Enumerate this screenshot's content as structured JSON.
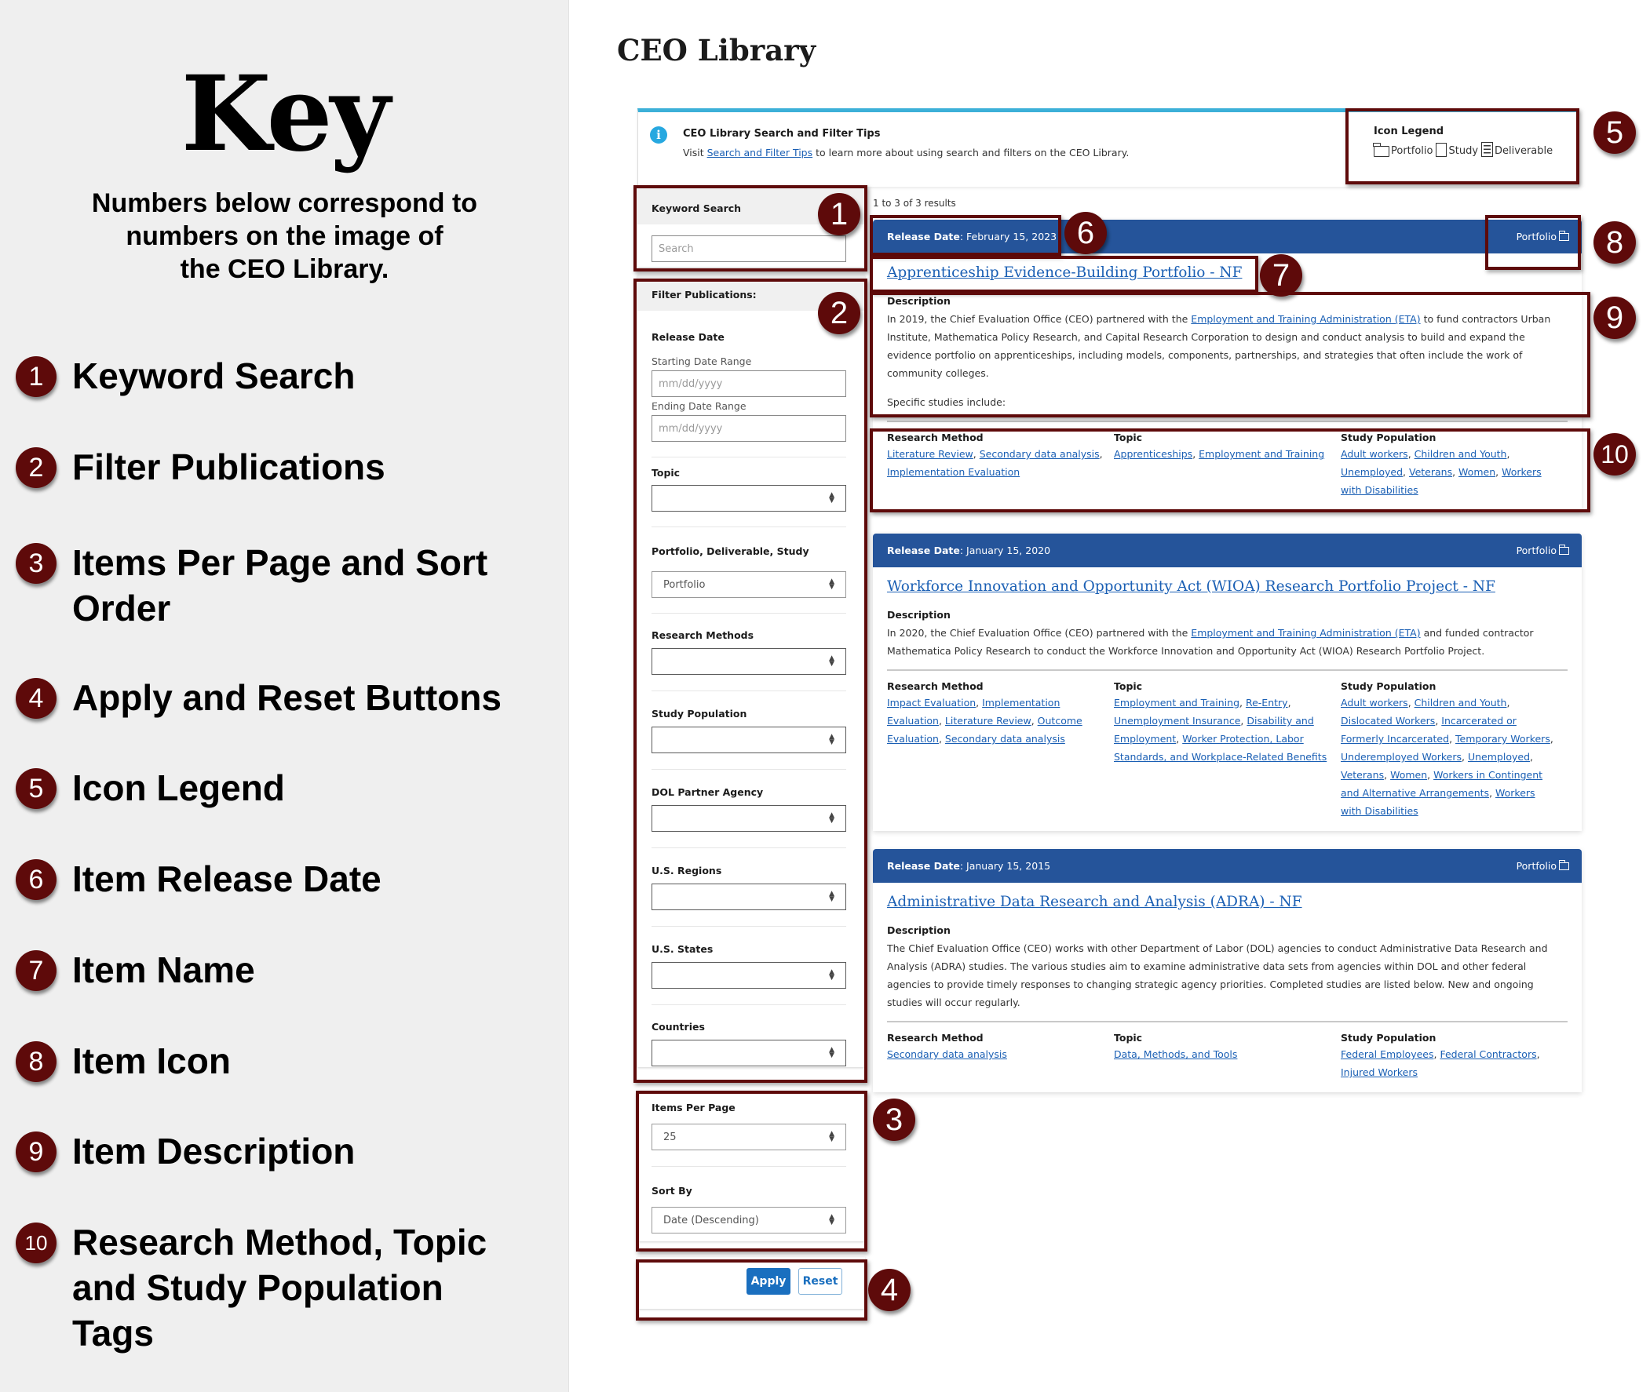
{
  "key": {
    "title": "Key",
    "subtitle_lines": [
      "Numbers below correspond to",
      "numbers on the image of",
      "the CEO Library."
    ],
    "items": [
      {
        "number": "1",
        "label": "Keyword Search"
      },
      {
        "number": "2",
        "label": "Filter Publications"
      },
      {
        "number": "3",
        "label": "Items Per Page and Sort Order"
      },
      {
        "number": "4",
        "label": "Apply and Reset Buttons"
      },
      {
        "number": "5",
        "label": "Icon Legend"
      },
      {
        "number": "6",
        "label": "Item Release Date"
      },
      {
        "number": "7",
        "label": "Item Name"
      },
      {
        "number": "8",
        "label": "Item Icon"
      },
      {
        "number": "9",
        "label": "Item Description"
      },
      {
        "number": "10",
        "label": "Research Method, Topic and Study Population Tags"
      }
    ]
  },
  "page": {
    "title": "CEO Library"
  },
  "tips": {
    "icon": "info-icon",
    "title": "CEO Library Search and Filter Tips",
    "body_prefix": "Visit ",
    "link": "Search and Filter Tips",
    "body_suffix": " to learn more about using search and filters on the CEO Library."
  },
  "legend": {
    "title": "Icon Legend",
    "items": [
      {
        "icon": "folder-icon",
        "label": "Portfolio"
      },
      {
        "icon": "document-icon",
        "label": "Study"
      },
      {
        "icon": "document-lines-icon",
        "label": "Deliverable"
      }
    ]
  },
  "sidebar": {
    "keyword": {
      "heading": "Keyword Search",
      "placeholder": "Search",
      "value": ""
    },
    "filters": {
      "heading": "Filter Publications:",
      "release_date": {
        "label": "Release Date",
        "start_label": "Starting Date Range",
        "start_placeholder": "mm/dd/yyyy",
        "end_label": "Ending Date Range",
        "end_placeholder": "mm/dd/yyyy"
      },
      "selects": [
        {
          "label": "Topic",
          "value": ""
        },
        {
          "label": "Portfolio, Deliverable, Study",
          "value": "Portfolio"
        },
        {
          "label": "Research Methods",
          "value": ""
        },
        {
          "label": "Study Population",
          "value": ""
        },
        {
          "label": "DOL Partner Agency",
          "value": ""
        },
        {
          "label": "U.S. Regions",
          "value": ""
        },
        {
          "label": "U.S. States",
          "value": ""
        },
        {
          "label": "Countries",
          "value": ""
        }
      ]
    },
    "paging": {
      "items_per_page_label": "Items Per Page",
      "items_per_page_value": "25",
      "sort_label": "Sort By",
      "sort_value": "Date (Descending)"
    },
    "buttons": {
      "apply": "Apply",
      "reset": "Reset"
    }
  },
  "results": {
    "count_text": "1 to 3 of 3 results",
    "release_label": "Release Date",
    "description_label": "Description",
    "tag_headings": {
      "method": "Research Method",
      "topic": "Topic",
      "population": "Study Population"
    },
    "items": [
      {
        "release_date": "February 15, 2023",
        "type": "Portfolio",
        "type_icon": "folder-icon",
        "title": "Apprenticeship Evidence-Building Portfolio - NF",
        "description_parts": [
          "In 2019, the Chief Evaluation Office (CEO) partnered with the ",
          "Employment and Training Administration (ETA)",
          " to fund contractors Urban Institute, Mathematica Policy Research, and Capital Research Corporation to design and conduct analysis to build and expand the evidence portfolio on apprenticeships, including models, components, partnerships, and strategies that often include the work of community colleges."
        ],
        "description_extra": "Specific studies include:",
        "methods": [
          "Literature Review",
          "Secondary data analysis",
          "Implementation Evaluation"
        ],
        "topics": [
          "Apprenticeships",
          "Employment and Training"
        ],
        "populations": [
          "Adult workers",
          "Children and Youth",
          "Unemployed",
          "Veterans",
          "Women",
          "Workers with Disabilities"
        ]
      },
      {
        "release_date": "January 15, 2020",
        "type": "Portfolio",
        "type_icon": "folder-icon",
        "title": "Workforce Innovation and Opportunity Act (WIOA) Research Portfolio Project - NF",
        "description_parts": [
          "In 2020, the Chief Evaluation Office (CEO) partnered with the ",
          "Employment and Training Administration (ETA)",
          " and funded contractor Mathematica Policy Research to conduct the Workforce Innovation and Opportunity Act (WIOA) Research Portfolio Project."
        ],
        "description_extra": "",
        "methods": [
          "Impact Evaluation",
          "Implementation Evaluation",
          "Literature Review",
          "Outcome Evaluation",
          "Secondary data analysis"
        ],
        "topics": [
          "Employment and Training",
          "Re-Entry",
          "Unemployment Insurance",
          "Disability and Employment",
          "Worker Protection, Labor Standards, and Workplace-Related Benefits"
        ],
        "populations": [
          "Adult workers",
          "Children and Youth",
          "Dislocated Workers",
          "Incarcerated or Formerly Incarcerated",
          "Temporary Workers",
          "Underemployed Workers",
          "Unemployed",
          "Veterans",
          "Women",
          "Workers in Contingent and Alternative Arrangements",
          "Workers with Disabilities"
        ]
      },
      {
        "release_date": "January 15, 2015",
        "type": "Portfolio",
        "type_icon": "folder-icon",
        "title": "Administrative Data Research and Analysis (ADRA) - NF",
        "description_parts": [
          "The Chief Evaluation Office (CEO) works with other Department of Labor (DOL) agencies to conduct Administrative Data Research and Analysis (ADRA) studies. The various studies aim to examine administrative data sets from agencies within DOL and other federal agencies to provide timely responses to changing strategic agency priorities. Completed studies are listed below. New and ongoing studies will occur regularly.",
          "",
          ""
        ],
        "description_extra": "",
        "methods": [
          "Secondary data analysis"
        ],
        "topics": [
          "Data, Methods, and Tools"
        ],
        "populations": [
          "Federal Employees",
          "Federal Contractors",
          "Injured Workers"
        ]
      }
    ]
  },
  "annotations": [
    "1",
    "2",
    "3",
    "4",
    "5",
    "6",
    "7",
    "8",
    "9",
    "10"
  ],
  "colors": {
    "annotation": "#5e0a0a",
    "header_blue": "#25549a",
    "link_blue": "#1a5fb4",
    "tips_border": "#3cb0d8",
    "apply_blue": "#1a6fbf"
  }
}
